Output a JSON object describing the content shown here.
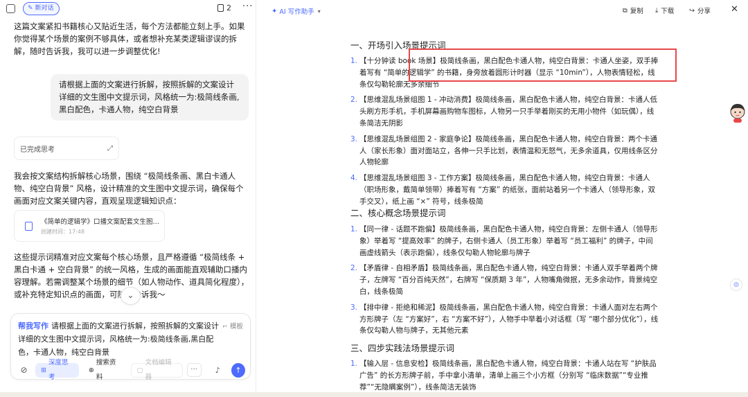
{
  "left_panel": {
    "new_chat_label": "新对话",
    "doc_count": "2",
    "more_label": "···",
    "messages": {
      "ai_intro": "这篇文案紧扣书籍核心又贴近生活，每个方法都能立刻上手。如果你觉得某个场景的案例不够具体，或者想补充某类逻辑谬误的拆解，随时告诉我，我可以进一步调整优化!",
      "user_request": "请根据上面的文案进行拆解，按照拆解的文案设计详细的文生图中文提示词，风格统一为:极简线条画,黑白配色，卡通人物，纯空白背景",
      "thinking_status": "已完成思考",
      "ai_answer": "我会按文案结构拆解核心场景，围绕 “极简线条画、黑白卡通人物、纯空白背景” 风格，设计精准的文生图中文提示词，确保每个画面对应文案关键内容，直观呈现逻辑知识点：",
      "doc_card_title": "《简单的逻辑学》口播文案配套文生图提...",
      "doc_card_time": "创建时间：17:48",
      "ai_summary": "这些提示词精准对应文案每个核心场景，且严格遵循 “极简线条 + 黑白卡通 + 空白背景” 的统一风格，生成的画面能直观辅助口播内容理解。若需调整某个场景的细节（如人物动作、道具简化程度），或补充特定知识点的画面，可随时告诉我～"
    },
    "input": {
      "help_tag": "帮我写作",
      "text": "请根据上面的文案进行拆解，按照拆解的文案设计详细的文生图中文提示词，风格统一为:极简线条画,黑白配色，卡通人物，纯空白背景",
      "template_label": "模板",
      "deep_think_label": "深度思考",
      "search_label": "搜索资料",
      "doc_edit_label": "文档编辑器"
    }
  },
  "right_panel": {
    "writer_label": "AI 写作助手",
    "copy_label": "复制",
    "download_label": "下载",
    "share_label": "分享",
    "close_label": "✕",
    "sections": [
      {
        "title": "一、开场引入场景提示词",
        "items": [
          {
            "num": "1.",
            "text": "【十分钟读 book 场景】极简线条画，黑白配色卡通人物，纯空白背景：卡通人坐姿，双手捧着写有 “简单的逻辑学” 的书籍，身旁放着圆形计时器（显示 “10min”），人物表情轻松，线条仅勾勒轮廓无多余细节"
          },
          {
            "num": "2.",
            "text": "【思维混乱场景组图 1 - 冲动消费】极简线条画，黑白配色卡通人物，纯空白背景：卡通人低头刷方形手机，手机屏幕画购物车图标，人物另一只手举着刚买的无用小物件（如玩偶），线条简洁无阴影"
          },
          {
            "num": "3.",
            "text": "【思维混乱场景组图 2 - 家庭争论】极简线条画，黑白配色卡通人物，纯空白背景：两个卡通人（家长形象）面对面站立，各伸一只手比划，表情温和无怒气，无多余道具，仅用线条区分人物轮廓"
          },
          {
            "num": "4.",
            "text": "【思维混乱场景组图 3 - 工作方案】极简线条画，黑白配色卡通人物，纯空白背景：卡通人（职场形象，戴简单领带）捧着写有 “方案” 的纸张，面前站着另一个卡通人（领导形象，双手交叉），纸上画 “×” 符号，线条极简"
          }
        ]
      },
      {
        "title": "二、核心概念场景提示词",
        "items": [
          {
            "num": "1.",
            "text": "【同一律 - 话题不跑偏】极简线条画，黑白配色卡通人物，纯空白背景：左侧卡通人（领导形象）举着写 “提高效率” 的牌子，右侧卡通人（员工形象）举着写 “员工福利” 的牌子，中间画虚线箭头（表示跑偏），线条仅勾勒人物轮廓与牌子"
          },
          {
            "num": "2.",
            "text": "【矛盾律 - 自相矛盾】极简线条画，黑白配色卡通人物，纯空白背景：卡通人双手举着两个牌子，左牌写 “百分百纯天然”，右牌写 “保质期 3 年”，人物嘴角微抿，无多余动作，背景纯空白，线条极简"
          },
          {
            "num": "3.",
            "text": "【排中律 - 拒绝和稀泥】极简线条画，黑白配色卡通人物，纯空白背景：卡通人面对左右两个方形牌子（左 “方案好”，右 “方案不好”），人物手中举着小对话框（写 “哪个部分优化”），线条仅勾勒人物与牌子，无其他元素"
          }
        ]
      },
      {
        "title": "三、四步实践法场景提示词",
        "items": [
          {
            "num": "1.",
            "text": "【输入层 - 信息安检】极简线条画，黑白配色卡通人物，纯空白背景：卡通人站在写 “护肤品广告” 的长方形牌子前，手中拿小清单，清单上画三个小方框（分别写 “临床数据”“专业推荐”“无隐瞒案例”），线条简洁无装饰"
          }
        ]
      }
    ]
  }
}
